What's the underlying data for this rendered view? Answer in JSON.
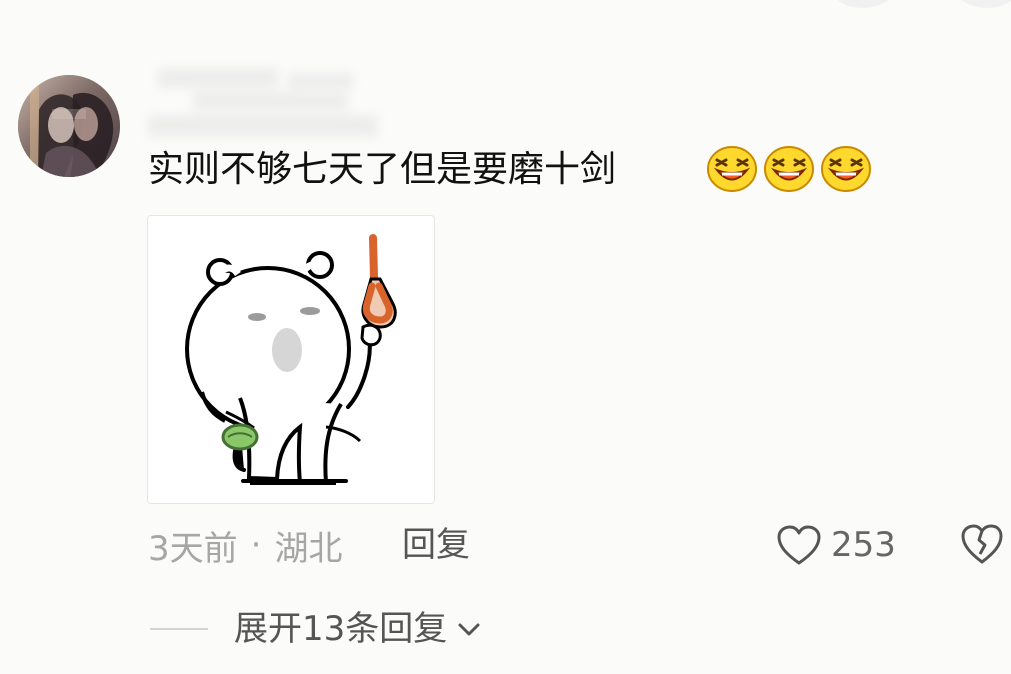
{
  "comment": {
    "text": "实则不够七天了但是要磨十剑",
    "emojis": [
      "grinning-squint-emoji",
      "grinning-squint-emoji",
      "grinning-squint-emoji"
    ],
    "time": "3天前",
    "separator": "·",
    "location": "湖北",
    "reply_label": "回复",
    "likes": "253"
  },
  "replies": {
    "expand_label": "展开13条回复"
  },
  "icons": {
    "like": "heart-outline-icon",
    "dislike": "broken-heart-icon",
    "expand": "chevron-down-icon"
  },
  "colors": {
    "background": "#fbfbfa",
    "text": "#111111",
    "muted": "#a6a6a6",
    "action": "#555555",
    "emoji_face": "#ffd82d",
    "emoji_mouth": "#ff5a24",
    "sticker_rope": "#d8632b",
    "sticker_purse": "#89c769"
  }
}
